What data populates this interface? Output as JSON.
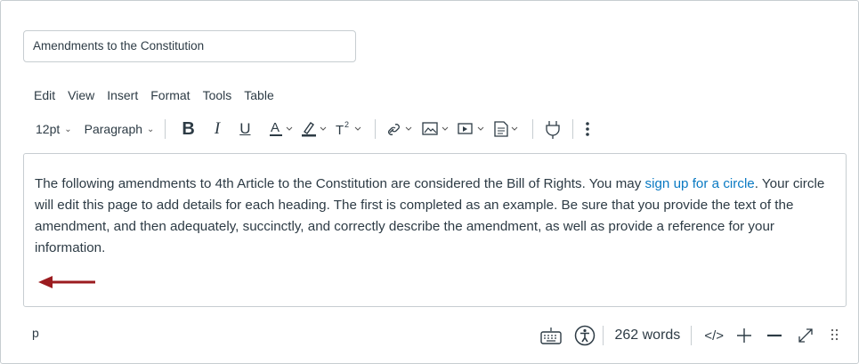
{
  "title_field": {
    "value": "Amendments to the Constitution"
  },
  "menu": [
    "Edit",
    "View",
    "Insert",
    "Format",
    "Tools",
    "Table"
  ],
  "toolbar": {
    "font_size": "12pt",
    "block_format": "Paragraph",
    "icons": [
      "bold-icon",
      "italic-icon",
      "underline-icon",
      "text-color-icon",
      "highlight-icon",
      "superscript-icon",
      "link-icon",
      "image-icon",
      "media-icon",
      "document-icon",
      "plugin-icon",
      "more-icon"
    ]
  },
  "editor": {
    "text_before_link": "The following amendments to 4th Article to the Constitution are considered the Bill of Rights. You may ",
    "link_text": "sign up for a circle",
    "text_after_link": ". Your circle will edit this page to add details for each heading. The first is completed as an example. Be sure that you provide the text of the amendment, and then adequately, succinctly, and correctly describe the amendment, as well as provide a reference for your information."
  },
  "statusbar": {
    "path": "p",
    "word_count": "262 words",
    "html_toggle": "</>"
  },
  "colors": {
    "link": "#0a7ac3",
    "arrow": "#9b1b1f",
    "text": "#2d3b45",
    "border": "#c7cdd1"
  }
}
